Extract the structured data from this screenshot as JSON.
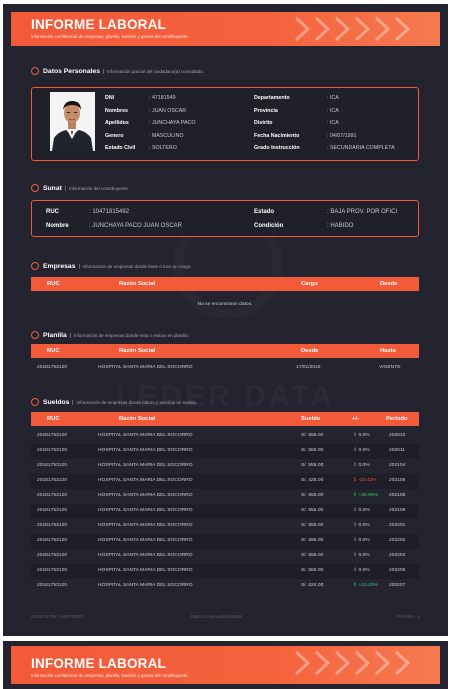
{
  "header": {
    "title": "INFORME LABORAL",
    "subtitle": "Información confidencial de empresas, planilla, sueldos y gastos del contribuyente."
  },
  "datos_personales": {
    "title": "Datos Personales",
    "desc": "Información parcial del ciudadano(a) consultado.",
    "left": [
      {
        "k": "DNI",
        "v": ": 47181549"
      },
      {
        "k": "Nombres",
        "v": ": JUAN OSCAR"
      },
      {
        "k": "Apellidos",
        "v": ": JUNCHAYA PACO"
      },
      {
        "k": "Genero",
        "v": ": MASCULINO"
      },
      {
        "k": "Estado Civil",
        "v": ": SOLTERO"
      }
    ],
    "right": [
      {
        "k": "Departamento",
        "v": ": ICA"
      },
      {
        "k": "Provincia",
        "v": ": ICA"
      },
      {
        "k": "Distrito",
        "v": ": ICA"
      },
      {
        "k": "Fecha Nacimiento",
        "v": ": 04/07/1991"
      },
      {
        "k": "Grado Instrucción",
        "v": ": SECUNDARIA COMPLETA"
      }
    ]
  },
  "sunat": {
    "title": "Sunat",
    "desc": "Información del contribuyente.",
    "ruc_k": "RUC",
    "ruc_v": ": 10471815492",
    "nombre_k": "Nombre",
    "nombre_v": ": JUNCHAYA PACO JUAN OSCAR",
    "estado_k": "Estado",
    "estado_v": ": BAJA PROV. POR OFICI",
    "condicion_k": "Condición",
    "condicion_v": ": HABIDO"
  },
  "empresas": {
    "title": "Empresas",
    "desc": "Información de empresas donde tiene o tuvo un cargo.",
    "columns": [
      "RUC",
      "Razón Social",
      "Cargo",
      "Desde"
    ],
    "empty": "No se encontraron datos."
  },
  "planilla": {
    "title": "Planilla",
    "desc": "Información de empresas donde esta o estuvo en planilla.",
    "columns": [
      "RUC",
      "Razón Social",
      "Desde",
      "Hasta"
    ],
    "rows": [
      [
        "20181753120",
        "HOSPITAL SANTA MARIA DEL SOCORRO",
        "17/01/2019",
        "VIGENTE"
      ]
    ]
  },
  "sueldos": {
    "title": "Sueldos",
    "desc": "Información de empresas donde laboro y percibio un sueldo.",
    "columns": [
      "RUC",
      "Razón Social",
      "Sueldo",
      "+/-",
      "Periodo"
    ],
    "rows": [
      {
        "ruc": "20181753120",
        "razon": "HOSPITAL SANTA MARIA DEL SOCORRO",
        "sueldo": "S/. 555.00",
        "var": "0.0%",
        "trend": "neu",
        "periodo": "202010"
      },
      {
        "ruc": "20181753120",
        "razon": "HOSPITAL SANTA MARIA DEL SOCORRO",
        "sueldo": "S/. 555.00",
        "var": "0.0%",
        "trend": "neu",
        "periodo": "202011"
      },
      {
        "ruc": "20181753120",
        "razon": "HOSPITAL SANTA MARIA DEL SOCORRO",
        "sueldo": "S/. 555.00",
        "var": "0.0%",
        "trend": "neu",
        "periodo": "202104"
      },
      {
        "ruc": "20181753120",
        "razon": "HOSPITAL SANTA MARIA DEL SOCORRO",
        "sueldo": "S/. 425.00",
        "var": "-23.42%",
        "trend": "neg",
        "periodo": "202105"
      },
      {
        "ruc": "20181753120",
        "razon": "HOSPITAL SANTA MARIA DEL SOCORRO",
        "sueldo": "S/. 555.00",
        "var": "+30.59%",
        "trend": "pos",
        "periodo": "202108"
      },
      {
        "ruc": "20181753120",
        "razon": "HOSPITAL SANTA MARIA DEL SOCORRO",
        "sueldo": "S/. 555.00",
        "var": "0.0%",
        "trend": "neu",
        "periodo": "202109"
      },
      {
        "ruc": "20181753120",
        "razon": "HOSPITAL SANTA MARIA DEL SOCORRO",
        "sueldo": "S/. 555.00",
        "var": "0.0%",
        "trend": "neu",
        "periodo": "202201"
      },
      {
        "ruc": "20181753120",
        "razon": "HOSPITAL SANTA MARIA DEL SOCORRO",
        "sueldo": "S/. 555.00",
        "var": "0.0%",
        "trend": "neu",
        "periodo": "202202"
      },
      {
        "ruc": "20181753120",
        "razon": "HOSPITAL SANTA MARIA DEL SOCORRO",
        "sueldo": "S/. 555.00",
        "var": "0.0%",
        "trend": "neu",
        "periodo": "202203"
      },
      {
        "ruc": "20181753120",
        "razon": "HOSPITAL SANTA MARIA DEL SOCORRO",
        "sueldo": "S/. 555.00",
        "var": "0.0%",
        "trend": "neu",
        "periodo": "202205"
      },
      {
        "ruc": "20181753120",
        "razon": "HOSPITAL SANTA MARIA DEL SOCORRO",
        "sueldo": "S/. 624.00",
        "var": "+12.43%",
        "trend": "pos",
        "periodo": "202207"
      }
    ]
  },
  "watermark": "LEDER DATA",
  "footer": {
    "left": "08:42:29 PM - 04/07/2025",
    "center": "https://t.me/LederDataBot",
    "right": "PÁGINA : 1"
  },
  "colors": {
    "accent": "#f25a3a",
    "page_bg": "#23242f",
    "positive": "#36d06b",
    "negative": "#ff4b4b"
  }
}
